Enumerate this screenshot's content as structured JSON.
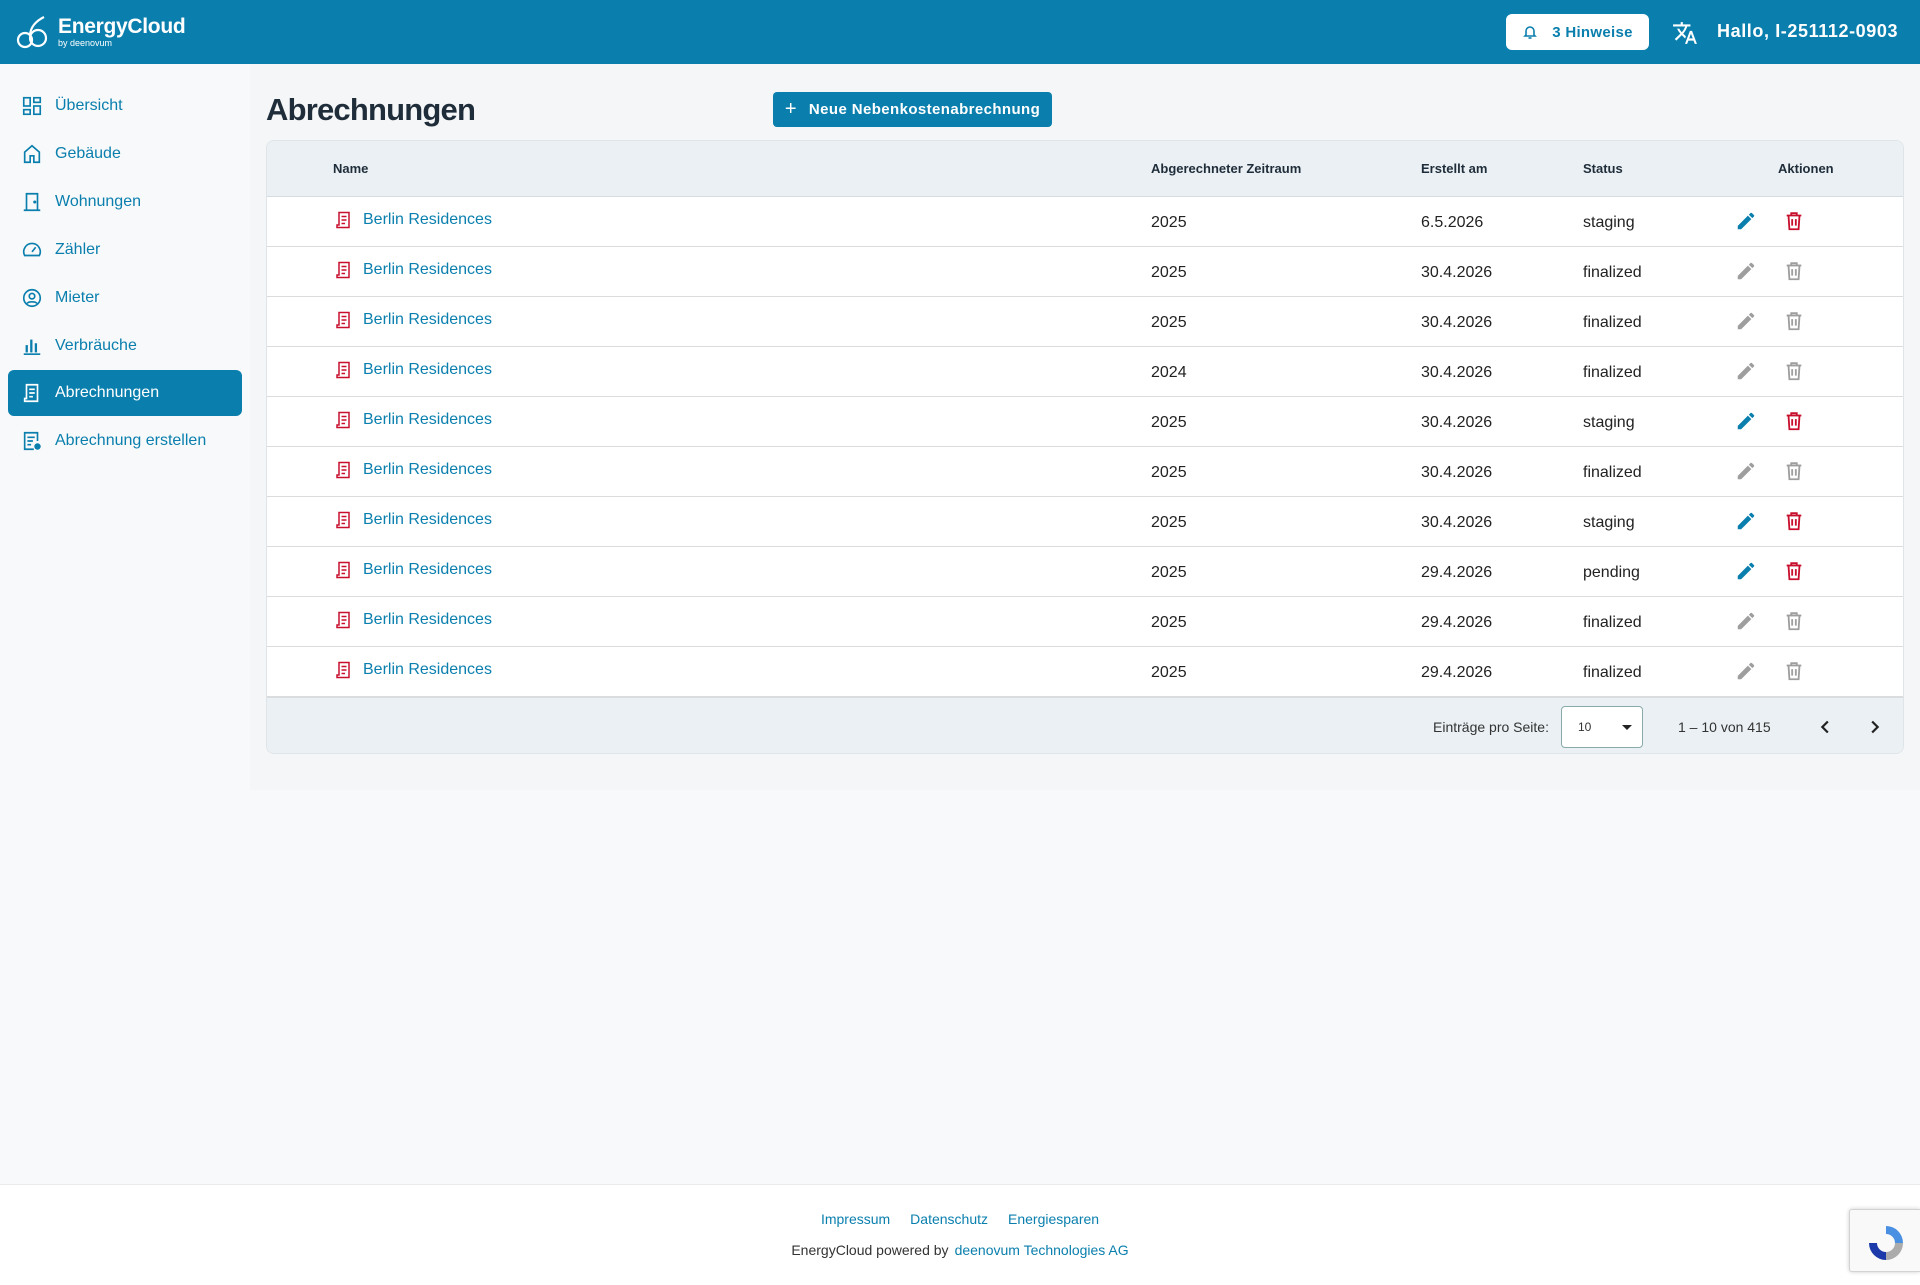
{
  "header": {
    "brand_name": "EnergyCloud",
    "brand_sub": "by deenovum",
    "hints_label": "3 Hinweise",
    "greeting": "Hallo, I-251112-0903"
  },
  "sidebar": {
    "items": [
      {
        "label": "Übersicht",
        "icon": "dashboard-icon"
      },
      {
        "label": "Gebäude",
        "icon": "home-icon"
      },
      {
        "label": "Wohnungen",
        "icon": "door-icon"
      },
      {
        "label": "Zähler",
        "icon": "speedometer-icon"
      },
      {
        "label": "Mieter",
        "icon": "person-circle-icon"
      },
      {
        "label": "Verbräuche",
        "icon": "bar-chart-icon"
      },
      {
        "label": "Abrechnungen",
        "icon": "receipt-icon",
        "active": true
      },
      {
        "label": "Abrechnung erstellen",
        "icon": "receipt-add-icon"
      }
    ]
  },
  "main": {
    "title": "Abrechnungen",
    "new_button_label": "Neue Nebenkostenabrechnung",
    "table": {
      "columns": [
        "Name",
        "Abgerechneter Zeitraum",
        "Erstellt am",
        "Status",
        "Aktionen"
      ],
      "rows": [
        {
          "name": "Berlin Residences",
          "period": "2025",
          "created": "6.5.2026",
          "status": "staging",
          "editable": true
        },
        {
          "name": "Berlin Residences",
          "period": "2025",
          "created": "30.4.2026",
          "status": "finalized",
          "editable": false
        },
        {
          "name": "Berlin Residences",
          "period": "2025",
          "created": "30.4.2026",
          "status": "finalized",
          "editable": false
        },
        {
          "name": "Berlin Residences",
          "period": "2024",
          "created": "30.4.2026",
          "status": "finalized",
          "editable": false
        },
        {
          "name": "Berlin Residences",
          "period": "2025",
          "created": "30.4.2026",
          "status": "staging",
          "editable": true
        },
        {
          "name": "Berlin Residences",
          "period": "2025",
          "created": "30.4.2026",
          "status": "finalized",
          "editable": false
        },
        {
          "name": "Berlin Residences",
          "period": "2025",
          "created": "30.4.2026",
          "status": "staging",
          "editable": true
        },
        {
          "name": "Berlin Residences",
          "period": "2025",
          "created": "29.4.2026",
          "status": "pending",
          "editable": true
        },
        {
          "name": "Berlin Residences",
          "period": "2025",
          "created": "29.4.2026",
          "status": "finalized",
          "editable": false
        },
        {
          "name": "Berlin Residences",
          "period": "2025",
          "created": "29.4.2026",
          "status": "finalized",
          "editable": false
        }
      ]
    },
    "pagination": {
      "per_page_label": "Einträge pro Seite:",
      "per_page_value": "10",
      "range": "1 – 10 von 415"
    }
  },
  "footer": {
    "links": [
      "Impressum",
      "Datenschutz",
      "Energiesparen"
    ],
    "credit": "EnergyCloud powered by",
    "credit_brand": "deenovum Technologies AG"
  },
  "colors": {
    "primary": "#0a7fae",
    "danger": "#c8102e",
    "disabled": "#9e9e9e"
  }
}
